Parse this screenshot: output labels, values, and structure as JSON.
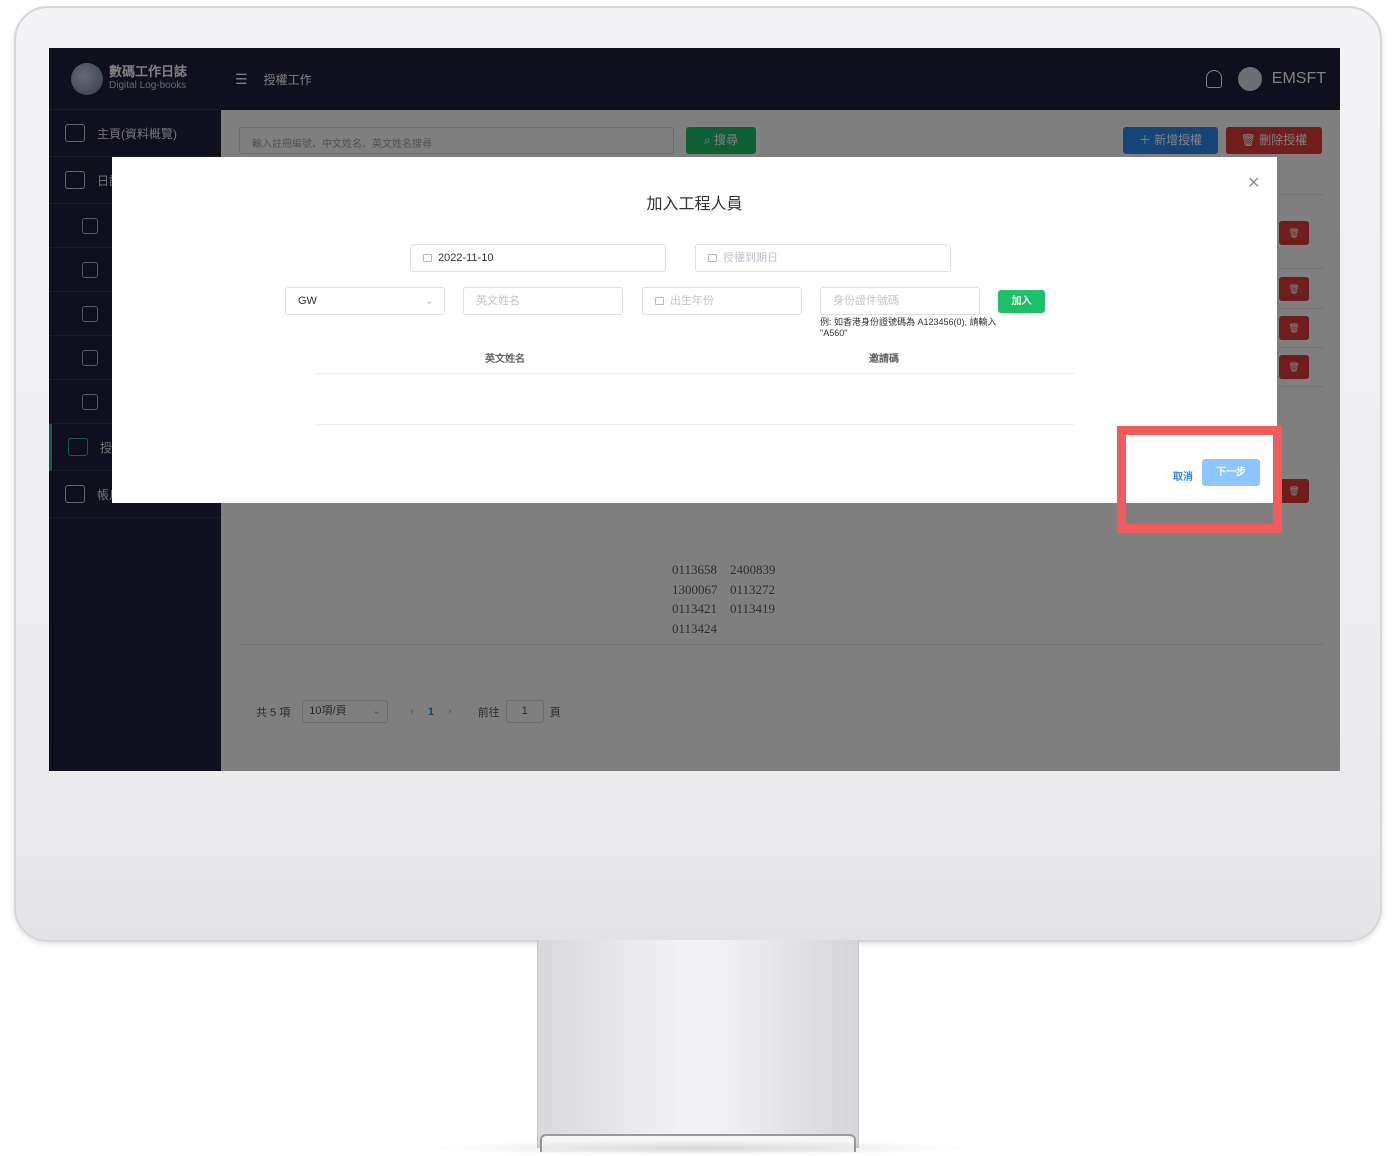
{
  "app": {
    "brand_cn": "數碼工作日誌",
    "brand_en": "Digital Log-books",
    "page_title": "授權工作",
    "username": "EMSFT"
  },
  "sidebar": {
    "items": [
      {
        "label": "主頁(資料概覽)"
      },
      {
        "label": "日誌"
      },
      {
        "label": "授"
      },
      {
        "label": "帳戶"
      }
    ]
  },
  "toolbar": {
    "search_placeholder": "輸入註冊編號、中文姓名、英文姓名搜尋",
    "search_label": "搜尋",
    "add_label": "新增授權",
    "delete_label": "刪除授權"
  },
  "background_codes": [
    [
      "0113658",
      "2400839"
    ],
    [
      "1300067",
      "0113272"
    ],
    [
      "0113421",
      "0113419"
    ],
    [
      "0113424",
      ""
    ]
  ],
  "pagination": {
    "total": "共 5 項",
    "page_size": "10項/頁",
    "current_page": "1",
    "goto_label": "前往",
    "goto_value": "1",
    "page_suffix": "頁"
  },
  "dialog": {
    "title": "加入工程人員",
    "start_date": "2022-11-10",
    "end_date_placeholder": "授權到期日",
    "type_value": "GW",
    "english_name_placeholder": "英文姓名",
    "birth_year_placeholder": "出生年份",
    "id_placeholder": "身份證件號碼",
    "join_label": "加入",
    "hint": "例: 如香港身份證號碼為 A123456(0), 請輸入 \"A560\"",
    "col_english_name": "英文姓名",
    "col_code": "邀請碼",
    "cancel_label": "取消",
    "next_label": "下一步"
  },
  "colors": {
    "sidebar_bg": "#1f1f3a",
    "primary": "#2d8cf0",
    "success": "#1fbf6a",
    "danger": "#e03b3b",
    "highlight": "#f15b5b"
  }
}
